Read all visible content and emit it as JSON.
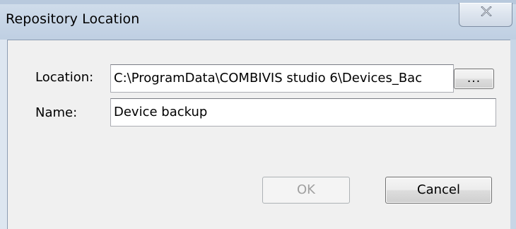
{
  "window": {
    "title": "Repository Location",
    "close_icon": "close-icon"
  },
  "form": {
    "location_label": "Location:",
    "location_value": "C:\\ProgramData\\COMBIVIS studio 6\\Devices_Bac",
    "browse_label": "...",
    "name_label": "Name:",
    "name_value": "Device backup"
  },
  "buttons": {
    "ok_label": "OK",
    "ok_enabled": false,
    "cancel_label": "Cancel"
  }
}
